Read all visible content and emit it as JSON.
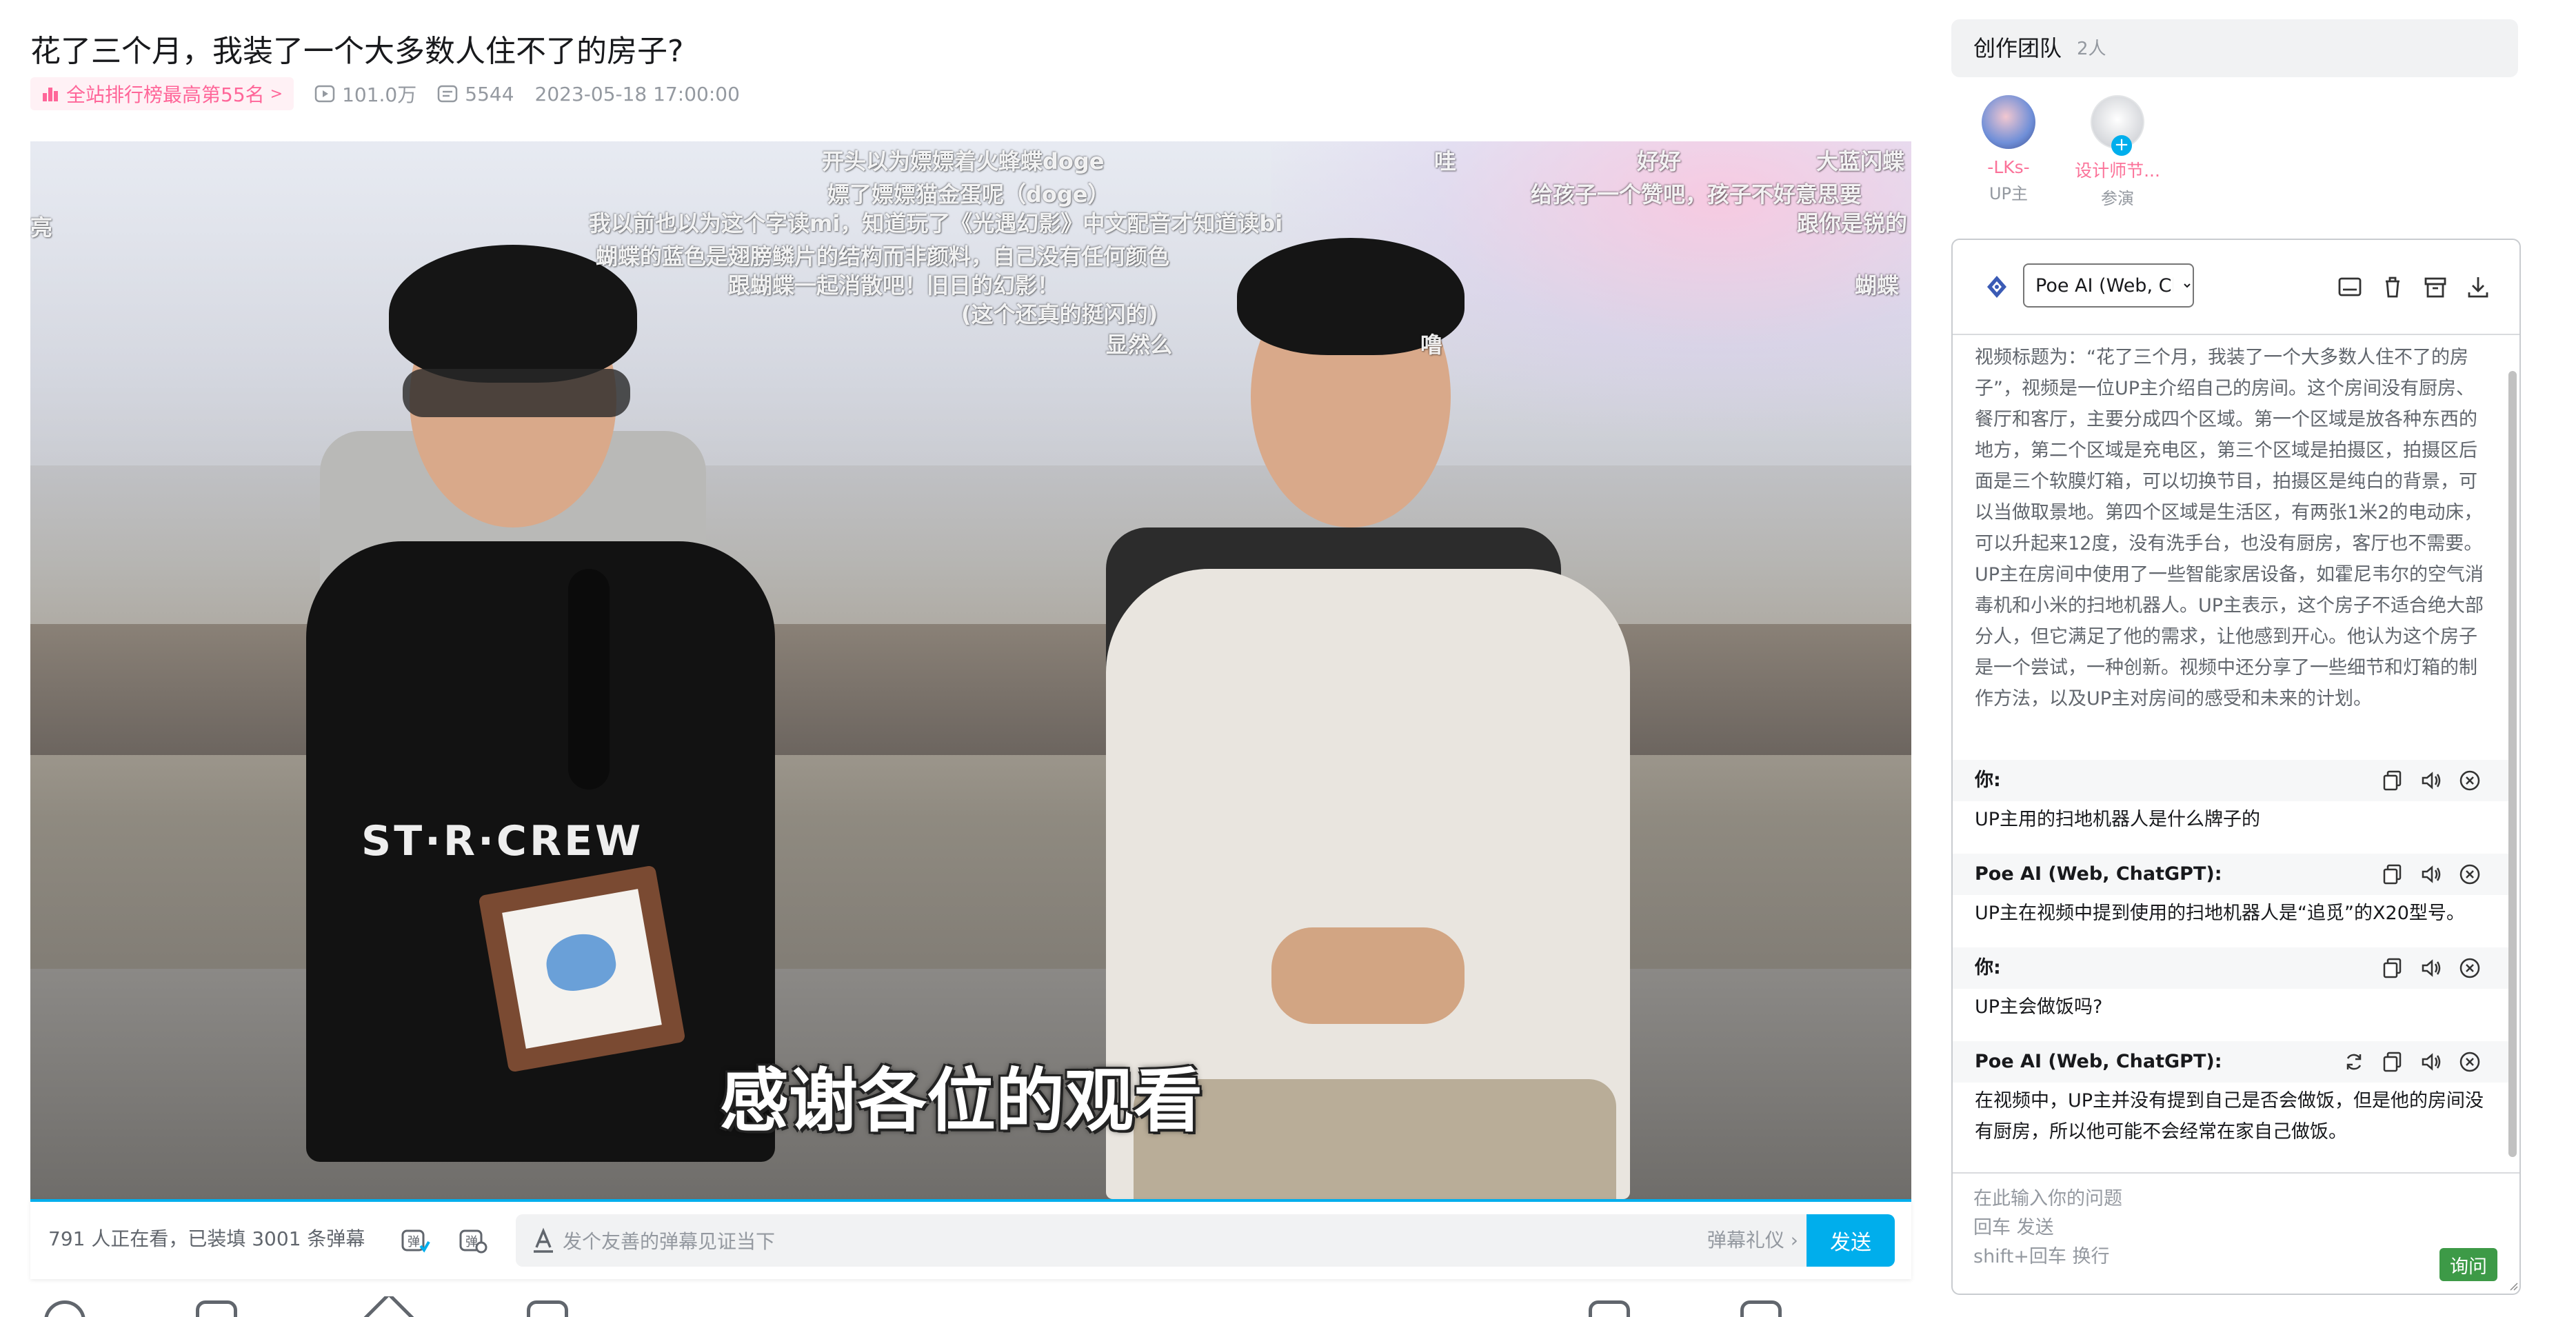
{
  "video": {
    "title": "花了三个月，我装了一个大多数人住不了的房子?",
    "rank_badge": "全站排行榜最高第55名",
    "views": "101.0万",
    "danmaku_count": "5544",
    "publish_time": "2023-05-18 17:00:00"
  },
  "player": {
    "subtitle": "感谢各位的观看",
    "shirt_text": "ST·R·CREW",
    "danmaku": [
      "开头以为嫖嫖着火蜂蝶doge",
      "哇",
      "好好",
      "大蓝闪蝶",
      "嫖了嫖嫖猫金蛋呢（doge）",
      "给孩子一个赞吧，孩子不好意思要",
      "亮",
      "我以前也以为这个字读mi，知道玩了《光遇幻影》中文配音才知道读bi",
      "跟你是锐的",
      "蝴蝶的蓝色是翅膀鳞片的结构而非颜料，自己没有任何颜色",
      "跟蝴蝶一起消散吧！旧日的幻影！",
      "蝴蝶",
      "(这个还真的挺闪的)",
      "显然么",
      "噜"
    ]
  },
  "sendbar": {
    "viewers_text": "791 人正在看，已装填 3001 条弹幕",
    "input_placeholder": "发个友善的弹幕见证当下",
    "etiquette": "弹幕礼仪 ›",
    "send_label": "发送"
  },
  "team": {
    "title": "创作团队",
    "count": "2人",
    "members": [
      {
        "name": "-LKs-",
        "role": "UP主"
      },
      {
        "name": "设计师节...",
        "role": "参演"
      }
    ]
  },
  "ai": {
    "model_selected": "Poe AI (Web, ChatGPT)",
    "summary": "视频标题为：“花了三个月，我装了一个大多数人住不了的房子”，视频是一位UP主介绍自己的房间。这个房间没有厨房、餐厅和客厅，主要分成四个区域。第一个区域是放各种东西的地方，第二个区域是充电区，第三个区域是拍摄区，拍摄区后面是三个软膜灯箱，可以切换节目，拍摄区是纯白的背景，可以当做取景地。第四个区域是生活区，有两张1米2的电动床，可以升起来12度，没有洗手台，也没有厨房，客厅也不需要。UP主在房间中使用了一些智能家居设备，如霍尼韦尔的空气消毒机和小米的扫地机器人。UP主表示，这个房子不适合绝大部分人，但它满足了他的需求，让他感到开心。他认为这个房子是一个尝试，一种创新。视频中还分享了一些细节和灯箱的制作方法，以及UP主对房间的感受和未来的计划。",
    "messages": [
      {
        "sender": "你:",
        "text": "UP主用的扫地机器人是什么牌子的"
      },
      {
        "sender": "Poe AI (Web, ChatGPT):",
        "text": "UP主在视频中提到使用的扫地机器人是“追觅”的X20型号。"
      },
      {
        "sender": "你:",
        "text": "UP主会做饭吗?"
      },
      {
        "sender": "Poe AI (Web, ChatGPT):",
        "text": "在视频中，UP主并没有提到自己是否会做饭，但是他的房间没有厨房，所以他可能不会经常在家自己做饭。"
      }
    ],
    "input_placeholder": "在此输入你的问题\n回车 发送\nshift+回车 换行",
    "ask_label": "询问"
  },
  "colors": {
    "accent": "#00aeec",
    "pink": "#ff6699",
    "ask_green": "#3d9a47"
  }
}
